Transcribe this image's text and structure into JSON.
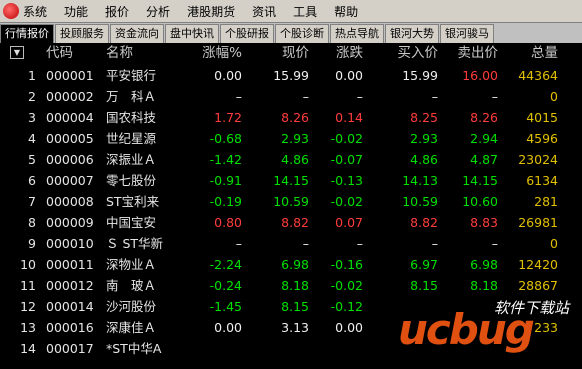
{
  "menu": [
    "系统",
    "功能",
    "报价",
    "分析",
    "港股期货",
    "资讯",
    "工具",
    "帮助"
  ],
  "tabs": [
    "行情报价",
    "投顾服务",
    "资金流向",
    "盘中快讯",
    "个股研报",
    "个股诊断",
    "热点导航",
    "银河大势",
    "银河骏马"
  ],
  "columns": [
    "代码",
    "名称",
    "涨幅%",
    "现价",
    "涨跌",
    "买入价",
    "卖出价",
    "总量"
  ],
  "sort_icon": "▼",
  "rows": [
    {
      "idx": "1",
      "code": "000001",
      "name": "平安银行",
      "pct": "0.00",
      "price": "15.99",
      "chg": "0.00",
      "bid": "15.99",
      "ask": "16.00",
      "vol": "44364",
      "colors": [
        "white",
        "white",
        "white",
        "white",
        "red"
      ]
    },
    {
      "idx": "2",
      "code": "000002",
      "name": "万　科Ａ",
      "pct": "–",
      "price": "–",
      "chg": "–",
      "bid": "–",
      "ask": "–",
      "vol": "0",
      "colors": [
        "white",
        "white",
        "white",
        "white",
        "white"
      ]
    },
    {
      "idx": "3",
      "code": "000004",
      "name": "国农科技",
      "pct": "1.72",
      "price": "8.26",
      "chg": "0.14",
      "bid": "8.25",
      "ask": "8.26",
      "vol": "4015",
      "colors": [
        "red",
        "red",
        "red",
        "red",
        "red"
      ]
    },
    {
      "idx": "4",
      "code": "000005",
      "name": "世纪星源",
      "pct": "-0.68",
      "price": "2.93",
      "chg": "-0.02",
      "bid": "2.93",
      "ask": "2.94",
      "vol": "4596",
      "colors": [
        "green",
        "green",
        "green",
        "green",
        "green"
      ]
    },
    {
      "idx": "5",
      "code": "000006",
      "name": "深振业Ａ",
      "pct": "-1.42",
      "price": "4.86",
      "chg": "-0.07",
      "bid": "4.86",
      "ask": "4.87",
      "vol": "23024",
      "colors": [
        "green",
        "green",
        "green",
        "green",
        "green"
      ]
    },
    {
      "idx": "6",
      "code": "000007",
      "name": "零七股份",
      "pct": "-0.91",
      "price": "14.15",
      "chg": "-0.13",
      "bid": "14.13",
      "ask": "14.15",
      "vol": "6134",
      "colors": [
        "green",
        "green",
        "green",
        "green",
        "green"
      ]
    },
    {
      "idx": "7",
      "code": "000008",
      "name": "ST宝利来",
      "pct": "-0.19",
      "price": "10.59",
      "chg": "-0.02",
      "bid": "10.59",
      "ask": "10.60",
      "vol": "281",
      "colors": [
        "green",
        "green",
        "green",
        "green",
        "green"
      ]
    },
    {
      "idx": "8",
      "code": "000009",
      "name": "中国宝安",
      "pct": "0.80",
      "price": "8.82",
      "chg": "0.07",
      "bid": "8.82",
      "ask": "8.83",
      "vol": "26981",
      "colors": [
        "red",
        "red",
        "red",
        "red",
        "red"
      ]
    },
    {
      "idx": "9",
      "code": "000010",
      "name": "Ｓ ST华新",
      "pct": "–",
      "price": "–",
      "chg": "–",
      "bid": "–",
      "ask": "–",
      "vol": "0",
      "colors": [
        "white",
        "white",
        "white",
        "white",
        "white"
      ]
    },
    {
      "idx": "10",
      "code": "000011",
      "name": "深物业Ａ",
      "pct": "-2.24",
      "price": "6.98",
      "chg": "-0.16",
      "bid": "6.97",
      "ask": "6.98",
      "vol": "12420",
      "colors": [
        "green",
        "green",
        "green",
        "green",
        "green"
      ]
    },
    {
      "idx": "11",
      "code": "000012",
      "name": "南　玻Ａ",
      "pct": "-0.24",
      "price": "8.18",
      "chg": "-0.02",
      "bid": "8.15",
      "ask": "8.18",
      "vol": "28867",
      "colors": [
        "green",
        "green",
        "green",
        "green",
        "green"
      ]
    },
    {
      "idx": "12",
      "code": "000014",
      "name": "沙河股份",
      "pct": "-1.45",
      "price": "8.15",
      "chg": "-0.12",
      "bid": "",
      "ask": "",
      "vol": "",
      "colors": [
        "green",
        "green",
        "green",
        "green",
        "green"
      ]
    },
    {
      "idx": "13",
      "code": "000016",
      "name": "深康佳Ａ",
      "pct": "0.00",
      "price": "3.13",
      "chg": "0.00",
      "bid": "",
      "ask": "",
      "vol": "233",
      "colors": [
        "white",
        "white",
        "white",
        "white",
        "white"
      ]
    },
    {
      "idx": "14",
      "code": "000017",
      "name": "*ST中华A",
      "pct": "",
      "price": "",
      "chg": "",
      "bid": "",
      "ask": "",
      "vol": "",
      "colors": [
        "white",
        "white",
        "white",
        "white",
        "white"
      ]
    }
  ],
  "watermark": {
    "main": "ucbug",
    "bug": "",
    "sub": "软件下载站",
    "domain": "com"
  }
}
